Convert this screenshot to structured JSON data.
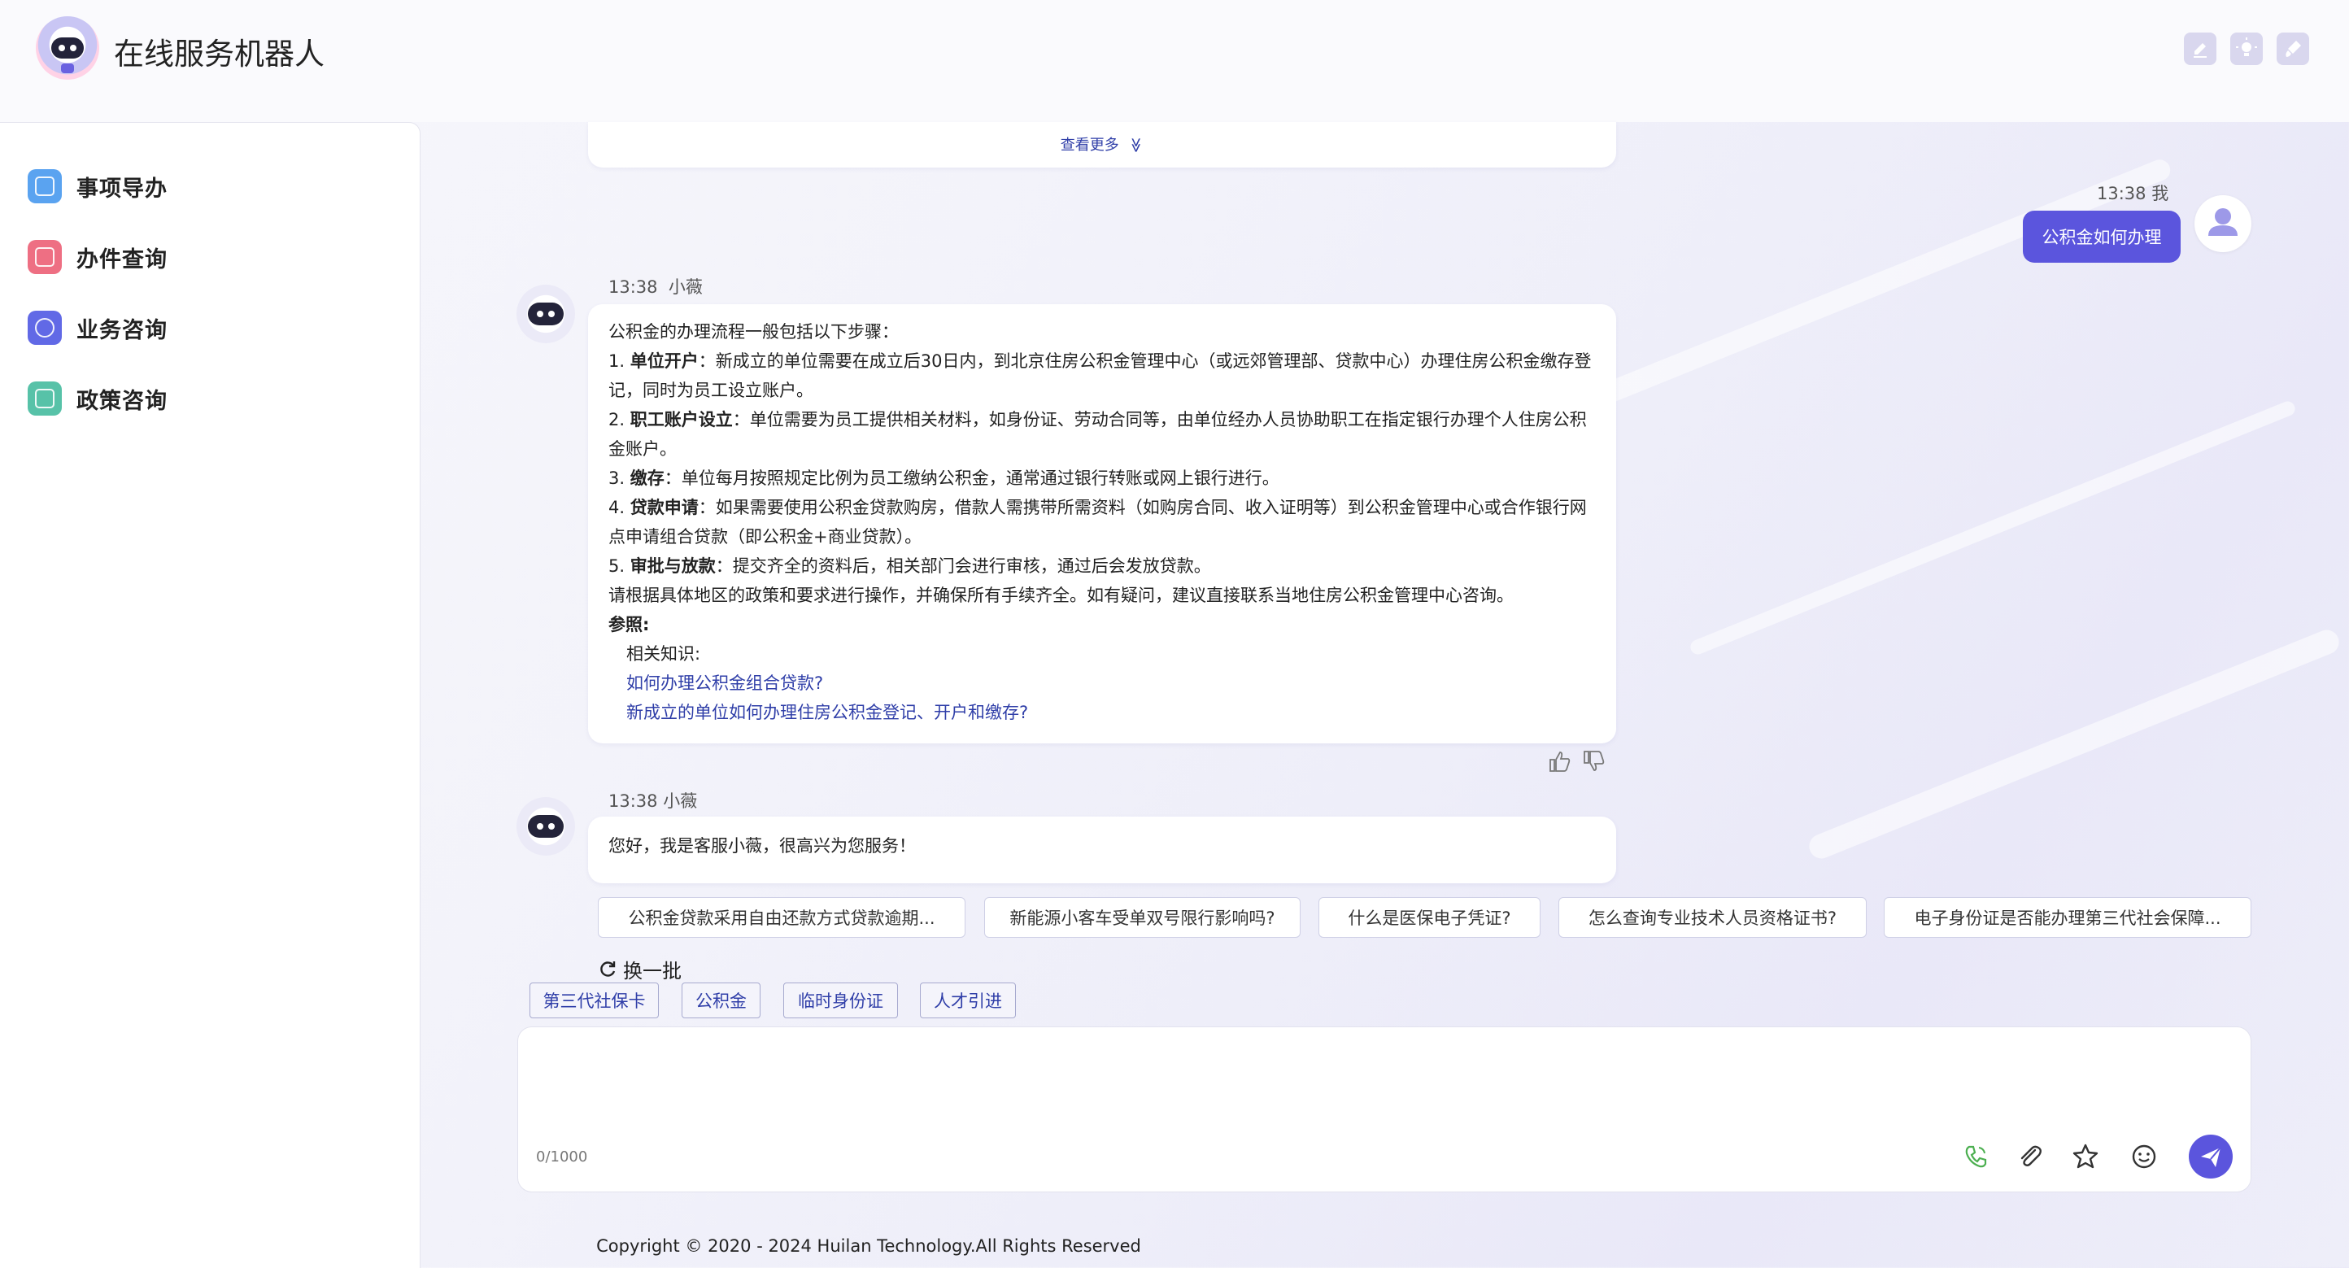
{
  "app": {
    "title": "在线服务机器人"
  },
  "sidebar": {
    "items": [
      {
        "label": "事项导办",
        "color": "#5aa3f0"
      },
      {
        "label": "办件查询",
        "color": "#ee6f83"
      },
      {
        "label": "业务咨询",
        "color": "#6169e6"
      },
      {
        "label": "政策咨询",
        "color": "#57c2a8"
      }
    ]
  },
  "chat": {
    "prev_card": {
      "view_more": "查看更多"
    },
    "user_message": {
      "time": "13:38",
      "sender": "我",
      "text": "公积金如何办理"
    },
    "bot_answer": {
      "time": "13:38",
      "sender": "小薇",
      "intro": "公积金的办理流程一般包括以下步骤：",
      "steps": [
        {
          "num": "1.",
          "title": "单位开户",
          "text1": "：新成立的单位需要在成立后30日内，到北京住房公积金管理中心（或远郊管理部、贷款中心）办理住房公积金缴存登",
          "text2": "记，同时为员工设立账户。"
        },
        {
          "num": "2.",
          "title": "职工账户设立",
          "text1": "：单位需要为员工提供相关材料，如身份证、劳动合同等，由单位经办人员协助职工在指定银行办理个人住房公积",
          "text2": "金账户。"
        },
        {
          "num": "3.",
          "title": "缴存",
          "text1": "：单位每月按照规定比例为员工缴纳公积金，通常通过银行转账或网上银行进行。",
          "text2": ""
        },
        {
          "num": "4.",
          "title": "贷款申请",
          "text1": "：如果需要使用公积金贷款购房，借款人需携带所需资料（如购房合同、收入证明等）到公积金管理中心或合作银行网",
          "text2": "点申请组合贷款（即公积金+商业贷款）。"
        },
        {
          "num": "5.",
          "title": "审批与放款",
          "text1": "：提交齐全的资料后，相关部门会进行审核，通过后会发放贷款。",
          "text2": ""
        }
      ],
      "closing": "请根据具体地区的政策和要求进行操作，并确保所有手续齐全。如有疑问，建议直接联系当地住房公积金管理中心咨询。",
      "ref_title": "参照:",
      "ref_sub": "相关知识:",
      "links": [
        "如何办理公积金组合贷款?",
        "新成立的单位如何办理住房公积金登记、开户和缴存?"
      ]
    },
    "greeting": {
      "time": "13:38",
      "sender": "小薇",
      "text": "您好，我是客服小薇，很高兴为您服务！"
    },
    "suggestions": [
      "公积金贷款采用自由还款方式贷款逾期...",
      "新能源小客车受单双号限行影响吗?",
      "什么是医保电子凭证?",
      "怎么查询专业技术人员资格证书?",
      "电子身份证是否能办理第三代社会保障..."
    ],
    "refresh_label": "换一批",
    "quick_tags": [
      "第三代社保卡",
      "公积金",
      "临时身份证",
      "人才引进"
    ]
  },
  "input": {
    "counter": "0/1000",
    "value": ""
  },
  "footer": {
    "copyright": "Copyright © 2020 - 2024 Huilan Technology.All Rights Reserved"
  },
  "colors": {
    "accent": "#5b55dd",
    "link": "#2f3ea8",
    "phone_icon": "#4caf50"
  }
}
